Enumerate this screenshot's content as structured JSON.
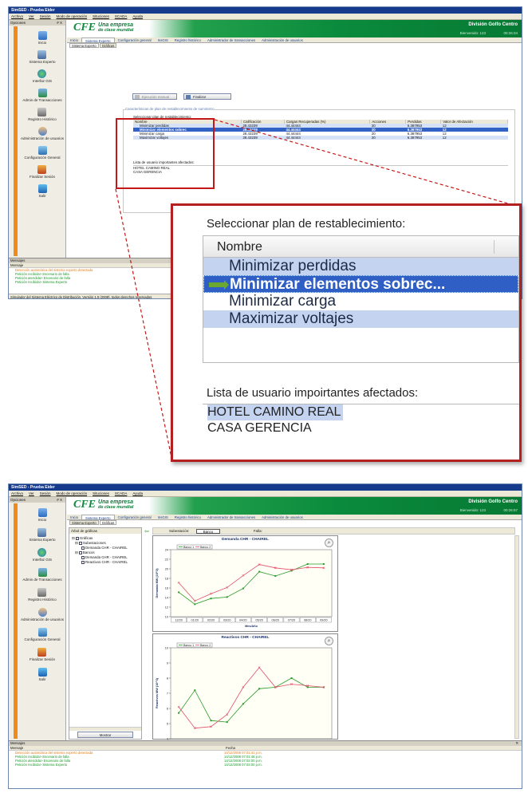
{
  "app": {
    "title": "SimSED - Prueba Eider",
    "menu": [
      "Archivo",
      "Ver",
      "Sesión",
      "Modo de operación",
      "Situciones",
      "SCADA",
      "Ayuda"
    ],
    "left_title": "Opciones",
    "left_close": "# X",
    "logo": {
      "cfe": "CFE",
      "line1": "Una empresa",
      "line2": "de clase mundial"
    },
    "division": "División Golfo Centro",
    "welcome": "Bienvenido: 123"
  },
  "nav": [
    "Inicio",
    "Sistema Experto",
    "Interfaz GIS",
    "Admin de Transacciones",
    "Registro Histórico",
    "Administración de usuarios",
    "Configuración General",
    "Finalizar Sesión",
    "Salir"
  ],
  "screen1": {
    "clock": "00:26:34",
    "tabs": [
      "Inicio",
      "Sistema Experto",
      "Configuración general",
      "InsGIS",
      "Registro histórico",
      "Administrador de transacciones",
      "Administración de usuarios"
    ],
    "subtabs": [
      "Sistema Experto",
      "Gráficas"
    ],
    "btn_manual": "Ejecución manual",
    "btn_finish": "Finalizar",
    "group_title": "Características de plan de restablecimiento de suministro",
    "plan_label": "Seleccionar plan de restablecimiento:",
    "columns": [
      "Nombre",
      "Calificación",
      "Cargas Recuperadas (%)",
      "Acciones",
      "Perdidas",
      "Valor de Afectación"
    ],
    "rows": [
      [
        "Minimizar perdidas",
        "28.43239",
        "44.44444",
        "20",
        "6.387953",
        "12"
      ],
      [
        "Minimizar elementos sobrec",
        "28.43239",
        "44.44444",
        "20",
        "6.387953",
        "12"
      ],
      [
        "Minimizar carga",
        "28.43239",
        "44.44444",
        "20",
        "6.387953",
        "12"
      ],
      [
        "Maximizar voltajes",
        "28.43239",
        "44.44444",
        "20",
        "6.387953",
        "12"
      ]
    ],
    "users_label": "Lista de usuario importantes afectados:",
    "users": [
      "HOTEL CAMINO REAL",
      "CASA GERENCIA"
    ],
    "msg_title": "Mensajes",
    "msg_col": "Mensaje",
    "messages": [
      {
        "text": "Detección automática del sistema experto detectada",
        "color": "#e08020"
      },
      {
        "text": "Petición recibida> Escenario de falla",
        "color": "#1a9a2a"
      },
      {
        "text": "Petición atendida> Escenario de falla",
        "color": "#1a9a2a"
      },
      {
        "text": "Petición recibida> Sistema Experto",
        "color": "#1a9a2a"
      }
    ],
    "status": "Simulador del Sistema Eléctrico de Distribución. Versión 1.0 (2008), todos derechos reservados"
  },
  "zoom": {
    "plan_label": "Seleccionar plan de restablecimiento:",
    "column": "Nombre",
    "rows": [
      "Minimizar perdidas",
      "Minimizar elementos sobrec...",
      "Minimizar carga",
      "Maximizar voltajes"
    ],
    "users_label": "Lista de usuario impoirtantes afectados:",
    "users": [
      "HOTEL CAMINO REAL",
      "CASA GERENCIA"
    ]
  },
  "screen2": {
    "clock": "00:26:57",
    "tree_title": "Árbol de gráficas",
    "tree": [
      "Gráficas",
      "Subestaciones",
      "Demanda CHR - CHAIREL",
      "Bancos",
      "Demanda CHR - CHAIREL",
      "Reactivos CHR - CHAIREL"
    ],
    "tree_btn": "Mostrar",
    "sub_label": "Subestación:",
    "sub_value": "Banco",
    "filter_label": "Falla:",
    "msg_title": "Mensajes",
    "msg_cols": [
      "Mensaje",
      "Fecha"
    ],
    "messages": [
      {
        "text": "Detección automática del sistema experto detectada",
        "date": "14/12/2008 07:01:41 p.m.",
        "color": "#e08020"
      },
      {
        "text": "Petición recibida> Escenario de falla",
        "date": "14/12/2008 07:01:46 p.m.",
        "color": "#1a9a2a"
      },
      {
        "text": "Petición atendida> Escenario de falla",
        "date": "14/12/2008 07:02:00 p.m.",
        "color": "#1a9a2a"
      },
      {
        "text": "Petición recibida> Sistema Experto",
        "date": "14/12/2008 07:03:00 p.m.",
        "color": "#1a9a2a"
      }
    ]
  },
  "chart_data": [
    {
      "type": "line",
      "title": "Demanda CHR - CHAIREL",
      "xlabel": "Mes/Año",
      "ylabel": "Demanda MW (10^3)",
      "categories": [
        "12/20",
        "01/20",
        "02/20",
        "03/20",
        "04/20",
        "05/20",
        "06/20",
        "07/20",
        "08/20",
        "09/20"
      ],
      "ylim": [
        10,
        24
      ],
      "series": [
        {
          "name": "Banco 1",
          "color": "#2a9a2a",
          "values": [
            15.1,
            12.6,
            13.8,
            14.1,
            15.9,
            19.4,
            18.5,
            19.6,
            21.0,
            21.0
          ]
        },
        {
          "name": "Banco 2",
          "color": "#e0506a",
          "values": [
            17.1,
            13.3,
            14.8,
            16.1,
            18.6,
            20.9,
            20.2,
            19.8,
            20.3,
            20.2
          ]
        }
      ]
    },
    {
      "type": "line",
      "title": "Reactivos CHR - CHAIREL",
      "xlabel": "",
      "ylabel": "Reactivos MW (10^3)",
      "categories": [
        "12/20",
        "01/20",
        "02/20",
        "03/20",
        "04/20",
        "05/20",
        "06/20",
        "07/20",
        "08/20",
        "09/20"
      ],
      "ylim": [
        4,
        10
      ],
      "series": [
        {
          "name": "Banco 1",
          "color": "#2a9a2a",
          "values": [
            5.7,
            7.2,
            5.2,
            5.1,
            6.3,
            7.3,
            7.4,
            8.0,
            7.4,
            7.4
          ]
        },
        {
          "name": "Banco 2",
          "color": "#e0506a",
          "values": [
            6.1,
            4.7,
            4.8,
            5.6,
            7.4,
            8.7,
            7.4,
            7.6,
            7.5,
            7.4
          ]
        }
      ]
    }
  ]
}
